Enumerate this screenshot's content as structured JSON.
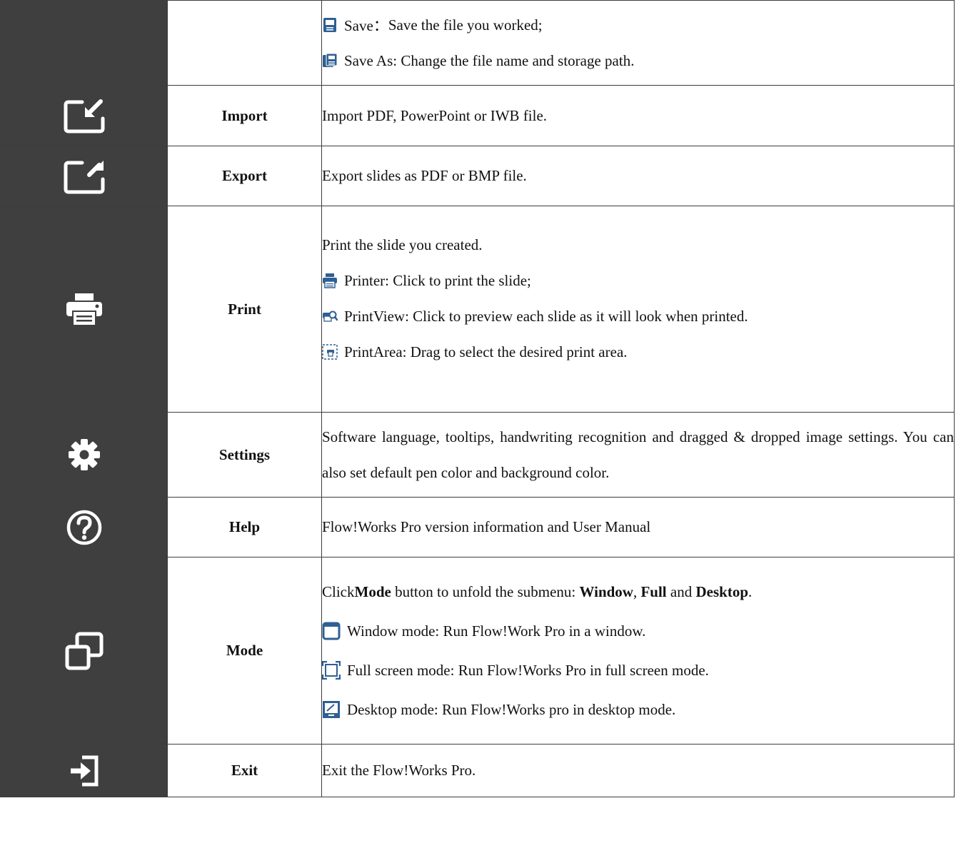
{
  "rows": {
    "save": {
      "save_label": "Save：",
      "save_desc": "Save the file you worked;",
      "saveas_text": "Save As: Change the file name and storage path."
    },
    "import": {
      "name": "Import",
      "icon": "import-icon",
      "desc": "Import PDF, PowerPoint or IWB file."
    },
    "export": {
      "name": "Export",
      "icon": "export-icon",
      "desc": "Export slides as PDF or BMP file."
    },
    "print": {
      "name": "Print",
      "icon": "printer-icon",
      "intro": "Print the slide you created.",
      "printer": "Printer: Click to print the slide;",
      "printview": "PrintView: Click to preview each slide as it will look when printed.",
      "printarea": "PrintArea: Drag to select the desired print area."
    },
    "settings": {
      "name": "Settings",
      "icon": "gear-icon",
      "desc": "Software language, tooltips, handwriting recognition and dragged & dropped image settings. You can also set default pen color and background color."
    },
    "help": {
      "name": "Help",
      "icon": "question-circle-icon",
      "desc": "Flow!Works Pro version information and User Manual"
    },
    "mode": {
      "name": "Mode",
      "icon": "windows-stack-icon",
      "intro_prefix": "Click ",
      "intro_mode": "Mode",
      "intro_mid": " button to unfold the submenu: ",
      "intro_window": "Window",
      "intro_comma": ", ",
      "intro_full": "Full",
      "intro_and": " and ",
      "intro_desktop": "Desktop",
      "intro_end": ".",
      "window": "Window mode: Run Flow!Work Pro in a window.",
      "full": "Full screen mode: Run Flow!Works Pro in full screen mode.",
      "desktop": "Desktop mode: Run Flow!Works pro in desktop mode."
    },
    "exit": {
      "name": "Exit",
      "icon": "exit-icon",
      "desc": "Exit the Flow!Works Pro."
    }
  },
  "colors": {
    "icon_column_bg": "#3f3f3f",
    "icon_fg": "#ffffff",
    "border": "#3d3d3d",
    "small_icon_blue": "#2f5f93"
  }
}
